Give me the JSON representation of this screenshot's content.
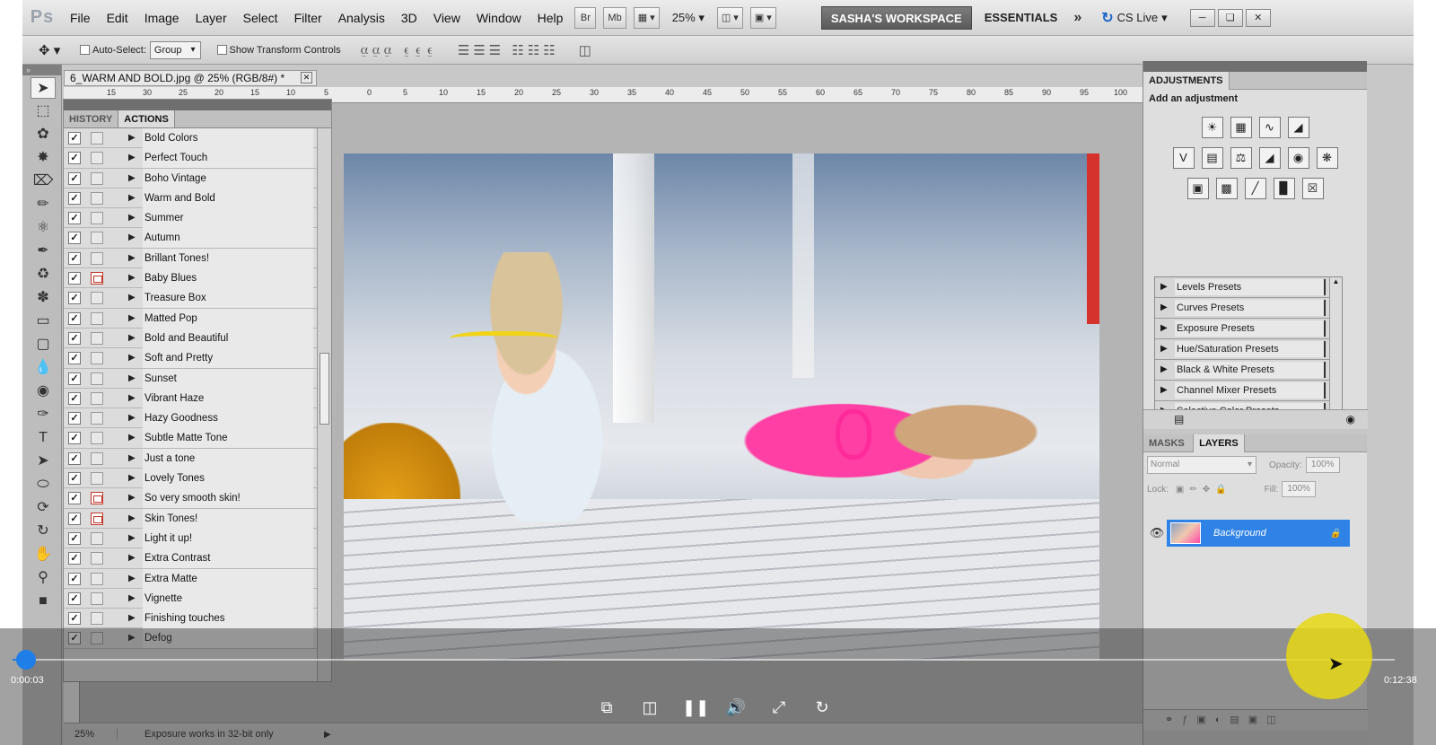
{
  "menubar": {
    "logo": "Ps",
    "items": [
      "File",
      "Edit",
      "Image",
      "Layer",
      "Select",
      "Filter",
      "Analysis",
      "3D",
      "View",
      "Window",
      "Help"
    ],
    "zoom": "25%",
    "workspace_active": "SASHA'S WORKSPACE",
    "workspace_essentials": "ESSENTIALS",
    "cs_live": "CS Live"
  },
  "options": {
    "auto_select_label": "Auto-Select:",
    "auto_select_value": "Group",
    "show_transform_label": "Show Transform Controls"
  },
  "document": {
    "tab_title": "6_WARM AND BOLD.jpg @ 25% (RGB/8#) *",
    "status_zoom": "25%",
    "status_info": "Exposure works in 32-bit only"
  },
  "actions_panel": {
    "tabs": [
      "HISTORY",
      "ACTIONS"
    ],
    "active_tab": "ACTIONS",
    "items": [
      {
        "name": "Bold Colors",
        "dialog": false
      },
      {
        "name": "Perfect Touch",
        "dialog": false
      },
      {
        "name": "Boho Vintage",
        "dialog": false
      },
      {
        "name": "Warm and Bold",
        "dialog": false
      },
      {
        "name": "Summer",
        "dialog": false
      },
      {
        "name": "Autumn",
        "dialog": false
      },
      {
        "name": "Brillant Tones!",
        "dialog": false
      },
      {
        "name": "Baby Blues",
        "dialog": true
      },
      {
        "name": "Treasure Box",
        "dialog": false
      },
      {
        "name": "Matted Pop",
        "dialog": false
      },
      {
        "name": "Bold and Beautiful",
        "dialog": false
      },
      {
        "name": "Soft and Pretty",
        "dialog": false
      },
      {
        "name": "Sunset",
        "dialog": false
      },
      {
        "name": "Vibrant Haze",
        "dialog": false
      },
      {
        "name": "Hazy Goodness",
        "dialog": false
      },
      {
        "name": "Subtle Matte Tone",
        "dialog": false
      },
      {
        "name": "Just a tone",
        "dialog": false
      },
      {
        "name": "Lovely Tones",
        "dialog": false
      },
      {
        "name": "So very smooth skin!",
        "dialog": true
      },
      {
        "name": "Skin Tones!",
        "dialog": true
      },
      {
        "name": "Light it up!",
        "dialog": false
      },
      {
        "name": "Extra Contrast",
        "dialog": false
      },
      {
        "name": "Extra Matte",
        "dialog": false
      },
      {
        "name": "Vignette",
        "dialog": false
      },
      {
        "name": "Finishing touches",
        "dialog": false
      },
      {
        "name": "Defog",
        "dialog": false
      }
    ]
  },
  "adjustments": {
    "tab": "ADJUSTMENTS",
    "title": "Add an adjustment",
    "presets": [
      "Levels Presets",
      "Curves Presets",
      "Exposure Presets",
      "Hue/Saturation Presets",
      "Black & White Presets",
      "Channel Mixer Presets",
      "Selective Color Presets"
    ]
  },
  "layers": {
    "tabs": [
      "MASKS",
      "LAYERS"
    ],
    "active_tab": "LAYERS",
    "blend_mode": "Normal",
    "opacity_label": "Opacity:",
    "opacity": "100%",
    "lock_label": "Lock:",
    "fill_label": "Fill:",
    "fill": "100%",
    "layer_name": "Background"
  },
  "player": {
    "current_time": "0:00:03",
    "total_time": "0:12:38",
    "progress": 0.004,
    "accent": "#1f7ee8"
  }
}
